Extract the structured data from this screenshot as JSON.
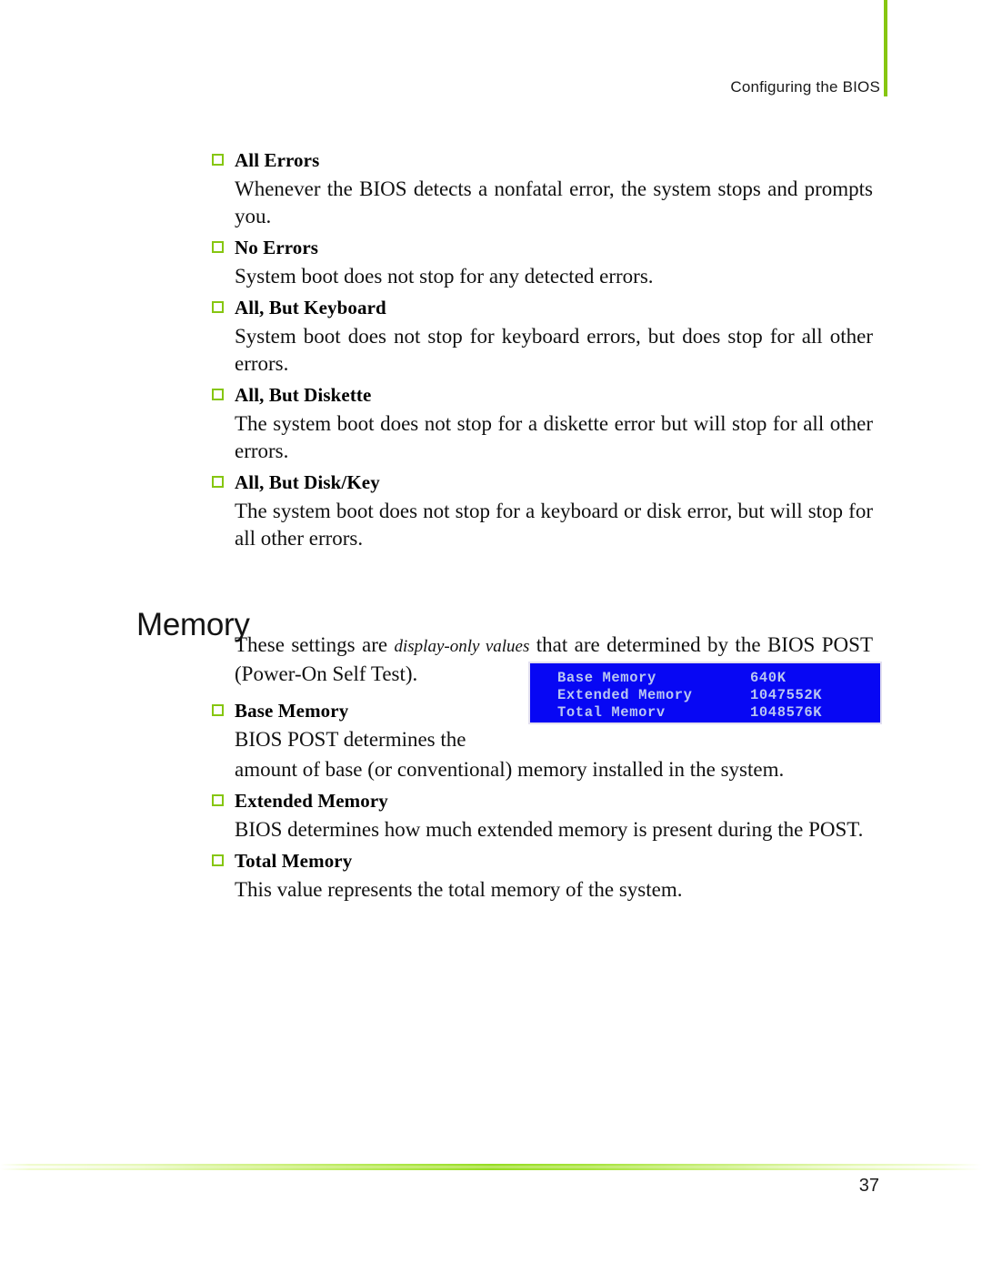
{
  "header": {
    "running_title": "Configuring the BIOS",
    "rule_color": "#86c611"
  },
  "bullet_color": "#86c611",
  "options": [
    {
      "label": "All Errors",
      "description": "Whenever the BIOS detects a nonfatal error, the system stops and prompts you."
    },
    {
      "label": "No Errors",
      "description": "System boot does not stop for any detected errors."
    },
    {
      "label": "All, But Keyboard",
      "description": "System boot does not stop for keyboard errors, but does stop for all other errors."
    },
    {
      "label": "All, But Diskette",
      "description": "The system boot does not stop for a diskette error but will stop for all other errors."
    },
    {
      "label": "All, But Disk/Key",
      "description": "The system boot does not stop for a keyboard or disk error, but will stop for all other errors."
    }
  ],
  "memory_section": {
    "heading": "Memory",
    "intro_before": "These settings are ",
    "intro_italic": "display-only values",
    "intro_after": " that are determined by the BIOS POST (Power-On Self Test).",
    "items": [
      {
        "label": "Base Memory",
        "description_line1": "BIOS POST determines the",
        "description_line2": "amount of base (or conventional) memory installed in the system."
      },
      {
        "label": "Extended Memory",
        "description": "BIOS determines how much extended memory is present during the POST."
      },
      {
        "label": "Total Memory",
        "description": "This value represents the total memory of the system."
      }
    ]
  },
  "bios_screen": {
    "background_color": "#0707f4",
    "text_color": "#b9c6f2",
    "rows": [
      {
        "label": "Base Memory",
        "value": "640K"
      },
      {
        "label": "Extended Memory",
        "value": "1047552K"
      },
      {
        "label": "Total Memorv",
        "value": "1048576K"
      }
    ]
  },
  "footer": {
    "page_number": "37",
    "bar_color": "#95dd22"
  }
}
